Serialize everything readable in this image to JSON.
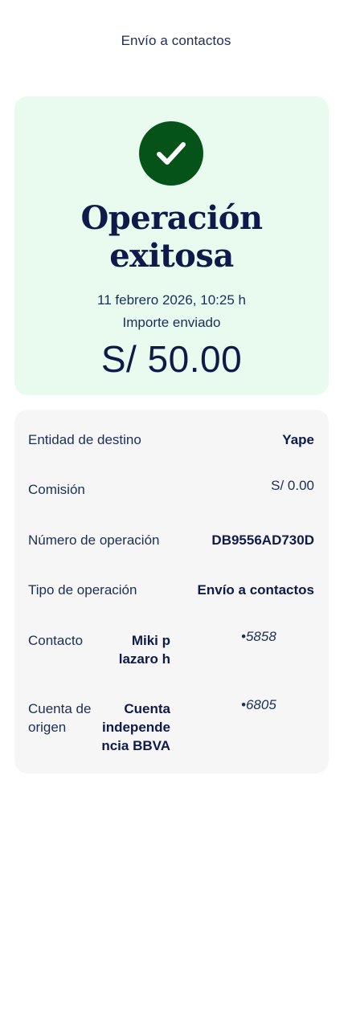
{
  "header": {
    "title": "Envío a contactos"
  },
  "success": {
    "icon": "check-icon",
    "title": "Operación exitosa",
    "datetime": "11 febrero 2026, 10:25 h",
    "amount_label": "Importe enviado",
    "amount": "S/ 50.00"
  },
  "details": {
    "entidad": {
      "label": "Entidad de destino",
      "value": "Yape"
    },
    "comision": {
      "label": "Comisión",
      "value": "S/ 0.00"
    },
    "numero": {
      "label": "Número de operación",
      "value": "DB9556AD730D"
    },
    "tipo": {
      "label": "Tipo de operación",
      "value": "Envío a contactos"
    },
    "contacto": {
      "label": "Contacto",
      "value": "Miki p lazaro h",
      "masked": "•5858"
    },
    "cuenta": {
      "label": "Cuenta de origen",
      "value": "Cuenta independencia BBVA",
      "masked": "•6805"
    }
  },
  "colors": {
    "success_bg": "#e8fbee",
    "success_icon": "#055319",
    "details_bg": "#f6f6f6",
    "text_primary": "#0f1a4b"
  }
}
